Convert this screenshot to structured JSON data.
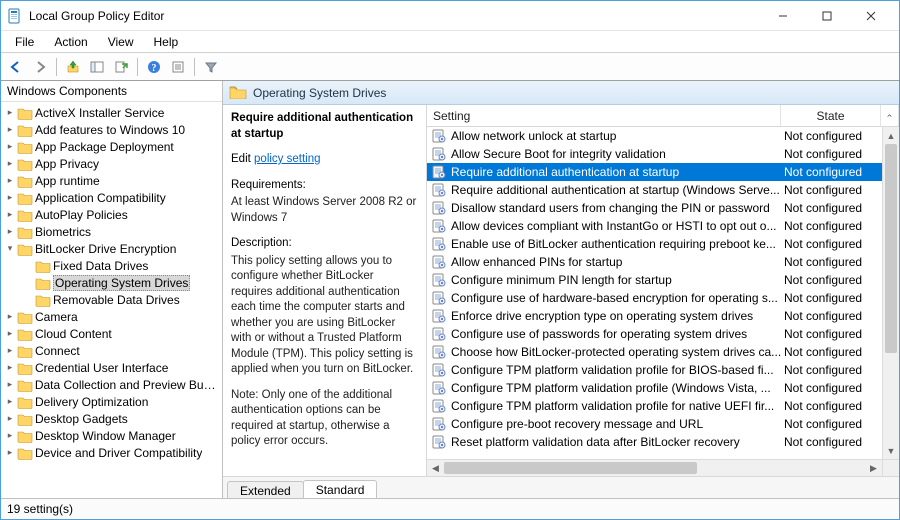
{
  "window": {
    "title": "Local Group Policy Editor"
  },
  "menu": {
    "items": [
      "File",
      "Action",
      "View",
      "Help"
    ]
  },
  "tree": {
    "header": "Windows Components",
    "items": [
      {
        "label": "ActiveX Installer Service",
        "depth": 0,
        "exp": "▸"
      },
      {
        "label": "Add features to Windows 10",
        "depth": 0,
        "exp": "▸"
      },
      {
        "label": "App Package Deployment",
        "depth": 0,
        "exp": "▸"
      },
      {
        "label": "App Privacy",
        "depth": 0,
        "exp": "▸"
      },
      {
        "label": "App runtime",
        "depth": 0,
        "exp": "▸"
      },
      {
        "label": "Application Compatibility",
        "depth": 0,
        "exp": "▸"
      },
      {
        "label": "AutoPlay Policies",
        "depth": 0,
        "exp": "▸"
      },
      {
        "label": "Biometrics",
        "depth": 0,
        "exp": "▸"
      },
      {
        "label": "BitLocker Drive Encryption",
        "depth": 0,
        "exp": "▾"
      },
      {
        "label": "Fixed Data Drives",
        "depth": 1,
        "exp": ""
      },
      {
        "label": "Operating System Drives",
        "depth": 1,
        "exp": "",
        "selected": true
      },
      {
        "label": "Removable Data Drives",
        "depth": 1,
        "exp": ""
      },
      {
        "label": "Camera",
        "depth": 0,
        "exp": "▸"
      },
      {
        "label": "Cloud Content",
        "depth": 0,
        "exp": "▸"
      },
      {
        "label": "Connect",
        "depth": 0,
        "exp": "▸"
      },
      {
        "label": "Credential User Interface",
        "depth": 0,
        "exp": "▸"
      },
      {
        "label": "Data Collection and Preview Builds",
        "depth": 0,
        "exp": "▸"
      },
      {
        "label": "Delivery Optimization",
        "depth": 0,
        "exp": "▸"
      },
      {
        "label": "Desktop Gadgets",
        "depth": 0,
        "exp": "▸"
      },
      {
        "label": "Desktop Window Manager",
        "depth": 0,
        "exp": "▸"
      },
      {
        "label": "Device and Driver Compatibility",
        "depth": 0,
        "exp": "▸"
      }
    ]
  },
  "path": {
    "label": "Operating System Drives"
  },
  "desc": {
    "title": "Require additional authentication at startup",
    "edit_label": "Edit",
    "link_label": "policy setting",
    "req_head": "Requirements:",
    "req_body": "At least Windows Server 2008 R2 or Windows 7",
    "desc_head": "Description:",
    "desc_body": "This policy setting allows you to configure whether BitLocker requires additional authentication each time the computer starts and whether you are using BitLocker with or without a Trusted Platform Module (TPM). This policy setting is applied when you turn on BitLocker.",
    "note_body": "Note: Only one of the additional authentication options can be required at startup, otherwise a policy error occurs."
  },
  "list": {
    "col_setting": "Setting",
    "col_state": "State",
    "rows": [
      {
        "name": "Allow network unlock at startup",
        "state": "Not configured"
      },
      {
        "name": "Allow Secure Boot for integrity validation",
        "state": "Not configured"
      },
      {
        "name": "Require additional authentication at startup",
        "state": "Not configured",
        "selected": true
      },
      {
        "name": "Require additional authentication at startup (Windows Serve...",
        "state": "Not configured"
      },
      {
        "name": "Disallow standard users from changing the PIN or password",
        "state": "Not configured"
      },
      {
        "name": "Allow devices compliant with InstantGo or HSTI to opt out o...",
        "state": "Not configured"
      },
      {
        "name": "Enable use of BitLocker authentication requiring preboot ke...",
        "state": "Not configured"
      },
      {
        "name": "Allow enhanced PINs for startup",
        "state": "Not configured"
      },
      {
        "name": "Configure minimum PIN length for startup",
        "state": "Not configured"
      },
      {
        "name": "Configure use of hardware-based encryption for operating s...",
        "state": "Not configured"
      },
      {
        "name": "Enforce drive encryption type on operating system drives",
        "state": "Not configured"
      },
      {
        "name": "Configure use of passwords for operating system drives",
        "state": "Not configured"
      },
      {
        "name": "Choose how BitLocker-protected operating system drives ca...",
        "state": "Not configured"
      },
      {
        "name": "Configure TPM platform validation profile for BIOS-based fi...",
        "state": "Not configured"
      },
      {
        "name": "Configure TPM platform validation profile (Windows Vista, ...",
        "state": "Not configured"
      },
      {
        "name": "Configure TPM platform validation profile for native UEFI fir...",
        "state": "Not configured"
      },
      {
        "name": "Configure pre-boot recovery message and URL",
        "state": "Not configured"
      },
      {
        "name": "Reset platform validation data after BitLocker recovery",
        "state": "Not configured"
      }
    ]
  },
  "tabs": {
    "extended": "Extended",
    "standard": "Standard"
  },
  "status": {
    "text": "19 setting(s)"
  }
}
